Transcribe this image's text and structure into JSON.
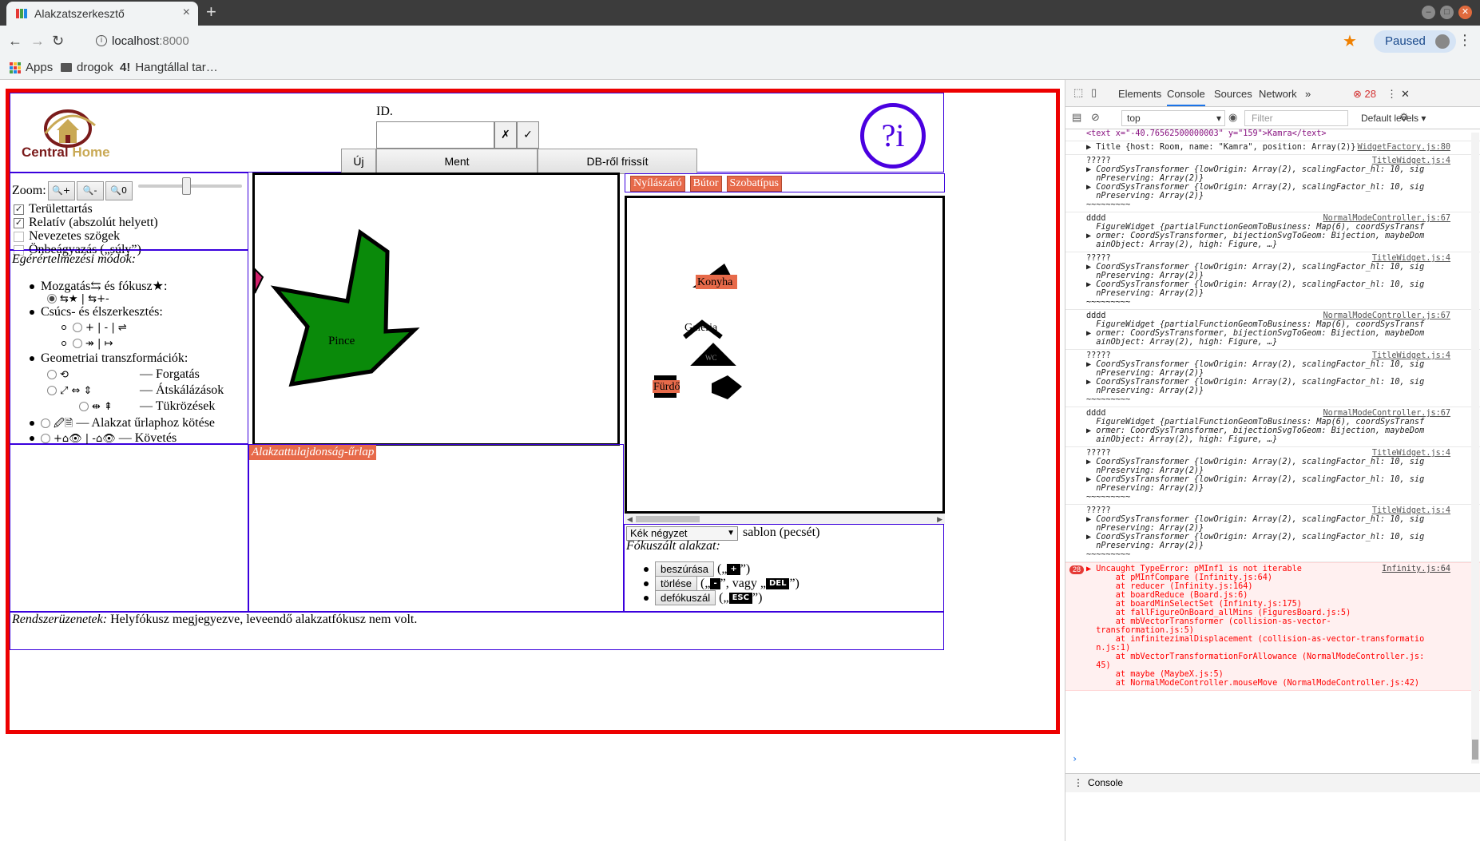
{
  "browser": {
    "tab_title": "Alakzatszerkesztő",
    "tab_close": "×",
    "new_tab": "+",
    "url_host": "localhost",
    "url_port": ":8000",
    "profile_label": "Paused",
    "bookmarks": [
      "Apps",
      "drogok",
      "Hangtállal tar…"
    ],
    "bookmark_logo": "4!"
  },
  "header": {
    "logo_central": "Central",
    "logo_home": "Home",
    "id_label": "ID.",
    "id_value": "",
    "clear_symbol": "✗",
    "confirm_symbol": "✓",
    "new_label": "Új",
    "save_label": "Ment",
    "refresh_label": "DB-ről frissít",
    "help_label": "?i"
  },
  "controls": {
    "zoom_label": "Zoom:",
    "zoom_in": "🔍+",
    "zoom_out": "🔍-",
    "zoom_reset": "🔍0",
    "slider_level": 0.47,
    "checkboxes": [
      {
        "label": "Területtartás",
        "checked": true
      },
      {
        "label": "Relatív (abszolút helyett)",
        "checked": true
      },
      {
        "label": "Nevezetes szögek",
        "checked": false
      },
      {
        "label": "Önbeágyazás („súly”)",
        "checked": false
      }
    ]
  },
  "modes": {
    "heading": "Egérértelmezési módok:",
    "move_focus": "Mozgatás⇆ és fókusz★:",
    "move_opts": "⇆★ |  ⇆+-",
    "vertex_edit": "Csúcs- és élszerkesztés:",
    "vertex_opts1": "+ |  - |  ⇌",
    "vertex_opts2": "↠ |  ↦",
    "geo_transforms": "Geometriai transzformációk:",
    "rotate_label": "— Forgatás",
    "scale_label": "— Átskálázások",
    "mirror_label": "— Tükrözések",
    "rotate_sym": "⟲",
    "scale_syms": "⤢  ⇔  ⇕",
    "mirror_syms": "⇹  ⇞",
    "bind_label": "— Alakzat űrlaphoz kötése",
    "bind_syms": "🖉🗎",
    "follow_label": "— Követés",
    "follow_syms": "+⌂👁 |  -⌂👁"
  },
  "canvas": {
    "main_shape_label": "Pince"
  },
  "palette": {
    "buttons": [
      "Nyílászáró",
      "Bútor",
      "Szobatípus"
    ],
    "labels": {
      "konyha": "Konyha",
      "galeria": "Galéria",
      "furdo": "Fürdő",
      "wc": "WC"
    }
  },
  "property_form": {
    "title": "Alakzattulajdonság-űrlap"
  },
  "template": {
    "select_value": "Kék négyzet",
    "suffix": "sablon (pecsét)",
    "focused_heading": "Fókuszált alakzat:",
    "insert_btn": "beszúrása",
    "delete_btn": "törlése",
    "defocus_btn": "defókuszál",
    "insert_key": "+",
    "delete_key": "-",
    "del_key": "DEL",
    "esc_key": "ESC",
    "insert_hint_pre": "(„",
    "insert_hint_post": "”)",
    "delete_hint_mid": "”, vagy „",
    "delete_hint_post": "”)"
  },
  "status": {
    "label": "Rendszerüzenetek:",
    "message": "Helyfókusz megjegyezve, leveendő alakzatfókusz nem volt."
  },
  "devtools": {
    "tabs": [
      "Elements",
      "Console",
      "Sources",
      "Network"
    ],
    "active_tab": "Console",
    "error_count": "28",
    "context": "top",
    "filter_placeholder": "Filter",
    "levels": "Default levels",
    "drawer_tab": "Console",
    "top_line": "<text x=\"-40.76562500000003\" y=\"159\">Kamra</text>",
    "entries": [
      {
        "src": "WidgetFactory.js:80",
        "lines": [
          "▶ Title {host: Room, name: \"Kamra\", position: Array(2)}"
        ]
      },
      {
        "src": "TitleWidget.js:4",
        "lines": [
          "?????",
          "▶ CoordSysTransformer {lowOrigin: Array(2), scalingFactor_hl: 10, sig",
          "  nPreserving: Array(2)}",
          "▶ CoordSysTransformer {lowOrigin: Array(2), scalingFactor_hl: 10, sig",
          "  nPreserving: Array(2)}",
          "~~~~~~~~~"
        ]
      },
      {
        "src": "NormalModeController.js:67",
        "lines": [
          "dddd",
          "  FigureWidget {partialFunctionGeomToBusiness: Map(6), coordSysTransf",
          "▶ ormer: CoordSysTransformer, bijectionSvgToGeom: Bijection, maybeDom",
          "  ainObject: Array(2), high: Figure, …}"
        ]
      },
      {
        "src": "TitleWidget.js:4",
        "lines": [
          "?????",
          "▶ CoordSysTransformer {lowOrigin: Array(2), scalingFactor_hl: 10, sig",
          "  nPreserving: Array(2)}",
          "▶ CoordSysTransformer {lowOrigin: Array(2), scalingFactor_hl: 10, sig",
          "  nPreserving: Array(2)}",
          "~~~~~~~~~"
        ]
      },
      {
        "src": "NormalModeController.js:67",
        "lines": [
          "dddd",
          "  FigureWidget {partialFunctionGeomToBusiness: Map(6), coordSysTransf",
          "▶ ormer: CoordSysTransformer, bijectionSvgToGeom: Bijection, maybeDom",
          "  ainObject: Array(2), high: Figure, …}"
        ]
      },
      {
        "src": "TitleWidget.js:4",
        "lines": [
          "?????",
          "▶ CoordSysTransformer {lowOrigin: Array(2), scalingFactor_hl: 10, sig",
          "  nPreserving: Array(2)}",
          "▶ CoordSysTransformer {lowOrigin: Array(2), scalingFactor_hl: 10, sig",
          "  nPreserving: Array(2)}",
          "~~~~~~~~~"
        ]
      },
      {
        "src": "NormalModeController.js:67",
        "lines": [
          "dddd",
          "  FigureWidget {partialFunctionGeomToBusiness: Map(6), coordSysTransf",
          "▶ ormer: CoordSysTransformer, bijectionSvgToGeom: Bijection, maybeDom",
          "  ainObject: Array(2), high: Figure, …}"
        ]
      },
      {
        "src": "TitleWidget.js:4",
        "lines": [
          "?????",
          "▶ CoordSysTransformer {lowOrigin: Array(2), scalingFactor_hl: 10, sig",
          "  nPreserving: Array(2)}",
          "▶ CoordSysTransformer {lowOrigin: Array(2), scalingFactor_hl: 10, sig",
          "  nPreserving: Array(2)}",
          "~~~~~~~~~"
        ]
      },
      {
        "src": "TitleWidget.js:4",
        "lines": [
          "?????",
          "▶ CoordSysTransformer {lowOrigin: Array(2), scalingFactor_hl: 10, sig",
          "  nPreserving: Array(2)}",
          "▶ CoordSysTransformer {lowOrigin: Array(2), scalingFactor_hl: 10, sig",
          "  nPreserving: Array(2)}",
          "~~~~~~~~~"
        ]
      }
    ],
    "error": {
      "count": "28",
      "src": "Infinity.js:64",
      "lines": [
        "▶ Uncaught TypeError: pMInf1 is not iterable",
        "      at pMInfCompare (Infinity.js:64)",
        "      at reducer (Infinity.js:164)",
        "      at boardReduce (Board.js:6)",
        "      at boardMinSelectSet (Infinity.js:175)",
        "      at fallFigureOnBoard_allMins (FiguresBoard.js:5)",
        "      at mbVectorTransformer (collision-as-vector-",
        "  transformation.js:5)",
        "      at infinitezimalDisplacement (collision-as-vector-transformatio",
        "  n.js:1)",
        "      at mbVectorTransformationForAllowance (NormalModeController.js:",
        "  45)",
        "      at maybe (MaybeX.js:5)",
        "      at NormalModeController.mouseMove (NormalModeController.js:42)"
      ]
    }
  }
}
